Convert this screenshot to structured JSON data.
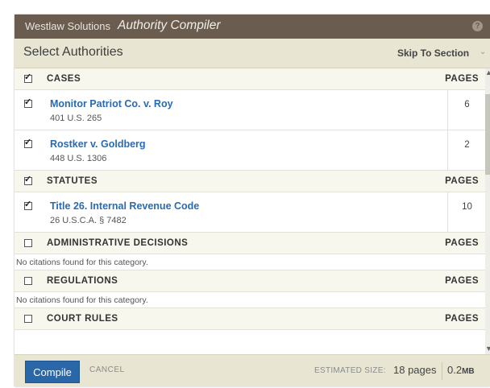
{
  "titlebar": {
    "brand": "Westlaw Solutions",
    "product": "Authority Compiler",
    "help_glyph": "?"
  },
  "subheader": {
    "title": "Select Authorities",
    "skip_label": "Skip To Section",
    "skip_caret": "⌄"
  },
  "sections": [
    {
      "label": "CASES",
      "pages_label": "PAGES",
      "checked": true
    },
    {
      "label": "STATUTES",
      "pages_label": "PAGES",
      "checked": true
    },
    {
      "label": "ADMINISTRATIVE DECISIONS",
      "pages_label": "PAGES",
      "checked": false
    },
    {
      "label": "REGULATIONS",
      "pages_label": "PAGES",
      "checked": false
    },
    {
      "label": "COURT RULES",
      "pages_label": "PAGES",
      "checked": false
    }
  ],
  "authorities": [
    {
      "name": "Monitor Patriot Co. v. Roy",
      "citation": "401 U.S. 265",
      "pages": "6",
      "checked": true
    },
    {
      "name": "Rostker v. Goldberg",
      "citation": "448 U.S. 1306",
      "pages": "2",
      "checked": true
    },
    {
      "name": "Title 26. Internal Revenue Code",
      "citation": "26 U.S.C.A. § 7482",
      "pages": "10",
      "checked": true
    }
  ],
  "empty_message": "No citations found for this category.",
  "footer": {
    "compile_label": "Compile",
    "cancel_label": "CANCEL",
    "estimated_label": "ESTIMATED SIZE:",
    "estimated_value": "18 pages",
    "size_value": "0.2",
    "size_unit": "MB"
  },
  "colors": {
    "titlebar": "#6a5d50",
    "header_band": "#e8e6d2",
    "link": "#2a6ab0",
    "primary_button": "#2a67a8"
  }
}
